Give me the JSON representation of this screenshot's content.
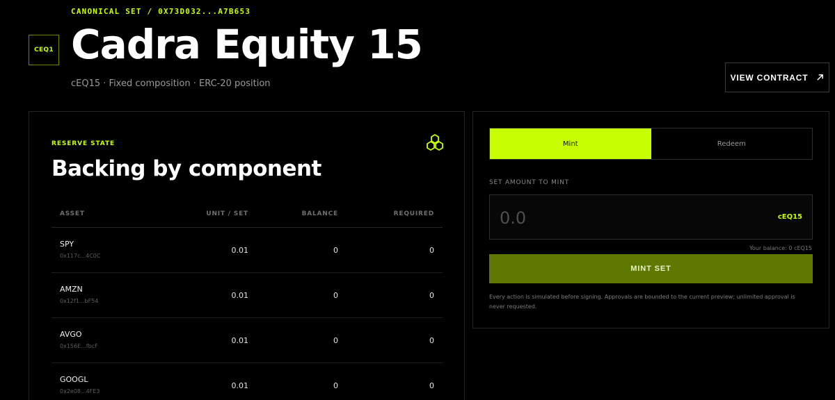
{
  "header": {
    "eyebrow": "CANONICAL SET / 0X73D032...A7B653",
    "badge": "CEQ1",
    "title": "Cadra Equity 15",
    "subtitle": "cEQ15 · Fixed composition · ERC-20 position",
    "view_contract_label": "VIEW CONTRACT",
    "view_contract_icon": "arrow-up-right-icon"
  },
  "reserve": {
    "label": "RESERVE STATE",
    "title": "Backing by component",
    "icon": "cubes-icon",
    "columns": [
      "ASSET",
      "UNIT / SET",
      "BALANCE",
      "REQUIRED"
    ],
    "rows": [
      {
        "symbol": "SPY",
        "address": "0x117c...4C0C",
        "unit": "0.01",
        "balance": "0",
        "required": "0"
      },
      {
        "symbol": "AMZN",
        "address": "0x12f1...bF54",
        "unit": "0.01",
        "balance": "0",
        "required": "0"
      },
      {
        "symbol": "AVGO",
        "address": "0x156E...fbcF",
        "unit": "0.01",
        "balance": "0",
        "required": "0"
      },
      {
        "symbol": "GOOGL",
        "address": "0x2e08...4FE3",
        "unit": "0.01",
        "balance": "0",
        "required": "0"
      }
    ]
  },
  "action": {
    "tabs": [
      {
        "label": "Mint",
        "active": true
      },
      {
        "label": "Redeem",
        "active": false
      }
    ],
    "amount_label": "SET AMOUNT TO MINT",
    "amount_placeholder": "0.0",
    "amount_unit": "cEQ15",
    "balance_text": "Your balance: 0 cEQ15",
    "submit_label": "MINT SET",
    "disclaimer": "Every action is simulated before signing. Approvals are bounded to the current preview; unlimited approval is never requested."
  },
  "colors": {
    "accent": "#c8ff00",
    "accent_dim": "#5f7800",
    "background": "#000000",
    "border": "#262626"
  }
}
